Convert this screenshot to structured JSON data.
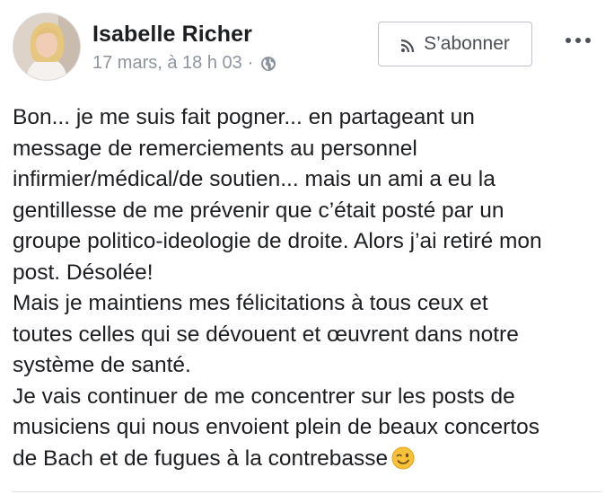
{
  "post": {
    "author": "Isabelle Richer",
    "timestamp": "17 mars, à 18 h 03",
    "separator": "·",
    "privacy_icon": "globe-icon",
    "subscribe_label": "S’abonner",
    "subscribe_icon": "rss-icon",
    "more_icon": "more-options-icon",
    "lines": [
      "Bon... je me suis fait pogner... en partageant un",
      "message de remerciements au personnel",
      "infirmier/médical/de soutien... mais un ami a eu la",
      "gentillesse de me prévenir que c’était posté par un",
      "groupe politico-ideologie de droite. Alors j’ai retiré mon",
      "post. Désolée!",
      "Mais je maintiens mes félicitations à tous ceux et",
      "toutes celles qui se dévouent et œuvrent dans notre",
      "système de santé.",
      "Je vais continuer de me concentrer sur les posts de",
      "musiciens qui nous envoient plein de beaux concertos",
      "de Bach et de fugues à la contrebasse"
    ],
    "emoji": "winking-face-emoji"
  }
}
